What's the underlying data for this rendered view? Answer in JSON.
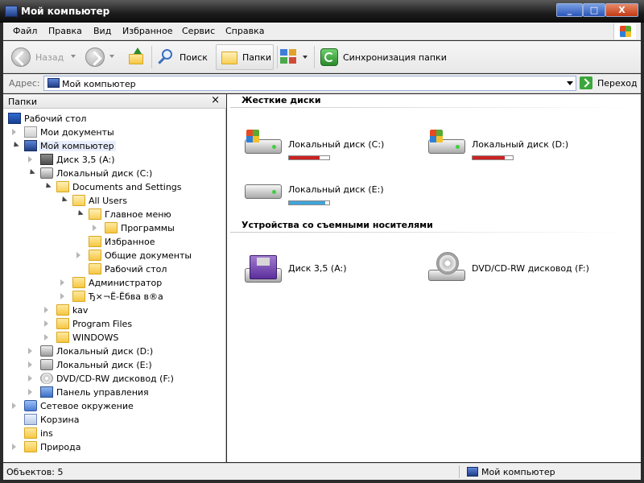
{
  "window": {
    "title": "Мой компьютер",
    "buttons": [
      "_",
      "□",
      "X"
    ]
  },
  "menu": [
    "Файл",
    "Правка",
    "Вид",
    "Избранное",
    "Сервис",
    "Справка"
  ],
  "toolbar": {
    "back_label": "Назад",
    "search_label": "Поиск",
    "folders_label": "Папки",
    "sync_label": "Синхронизация папки"
  },
  "address": {
    "label": "Адрес:",
    "value": "Мой компьютер",
    "go_label": "Переход"
  },
  "folders_pane": {
    "title": "Папки",
    "close": "×",
    "tree": [
      {
        "label": "Рабочий стол",
        "icon": "desktop-icon"
      },
      {
        "label": "Мои документы",
        "icon": "documents-icon"
      },
      {
        "label": "Мой компьютер",
        "icon": "computer-icon",
        "selected": true
      },
      {
        "label": "Диск 3,5 (A:)",
        "icon": "floppy-icon"
      },
      {
        "label": "Локальный диск (C:)",
        "icon": "system-drive-icon"
      },
      {
        "label": "Documents and Settings",
        "icon": "folder-icon"
      },
      {
        "label": "All Users",
        "icon": "folder-icon"
      },
      {
        "label": "Главное меню",
        "icon": "folder-icon"
      },
      {
        "label": "Программы",
        "icon": "folder-icon"
      },
      {
        "label": "Избранное",
        "icon": "folder-icon"
      },
      {
        "label": "Общие документы",
        "icon": "folder-icon"
      },
      {
        "label": "Рабочий стол",
        "icon": "folder-icon"
      },
      {
        "label": "Администратор",
        "icon": "folder-icon"
      },
      {
        "label": "Ђ×¬Ё-Ёбва в®а",
        "icon": "folder-icon"
      },
      {
        "label": "kav",
        "icon": "folder-icon"
      },
      {
        "label": "Program Files",
        "icon": "folder-icon"
      },
      {
        "label": "WINDOWS",
        "icon": "folder-icon"
      },
      {
        "label": "Локальный диск (D:)",
        "icon": "drive-icon"
      },
      {
        "label": "Локальный диск (E:)",
        "icon": "drive-icon"
      },
      {
        "label": "DVD/CD-RW дисковод (F:)",
        "icon": "cd-drive-icon"
      },
      {
        "label": "Панель управления",
        "icon": "control-panel-icon"
      },
      {
        "label": "Сетевое окружение",
        "icon": "network-icon"
      },
      {
        "label": "Корзина",
        "icon": "recycle-bin-icon"
      },
      {
        "label": "ins",
        "icon": "folder-icon"
      },
      {
        "label": "Природа",
        "icon": "folder-icon"
      }
    ]
  },
  "content": {
    "groups": [
      {
        "title": "Жесткие диски",
        "items": [
          {
            "name": "Локальный диск (C:)",
            "icon": "system-drive-icon",
            "usage": 0.75,
            "usage_color": "#cc2222"
          },
          {
            "name": "Локальный диск (D:)",
            "icon": "system-drive-icon",
            "usage": 0.8,
            "usage_color": "#cc2222"
          },
          {
            "name": "Локальный диск (E:)",
            "icon": "drive-icon",
            "usage": 0.9,
            "usage_color": "#3fa5d9"
          }
        ]
      },
      {
        "title": "Устройства со съемными носителями",
        "items": [
          {
            "name": "Диск 3,5 (A:)",
            "icon": "floppy-icon"
          },
          {
            "name": "DVD/CD-RW дисковод (F:)",
            "icon": "cd-drive-icon"
          }
        ]
      }
    ]
  },
  "status": {
    "left": "Объектов: 5",
    "right": "Мой компьютер"
  }
}
